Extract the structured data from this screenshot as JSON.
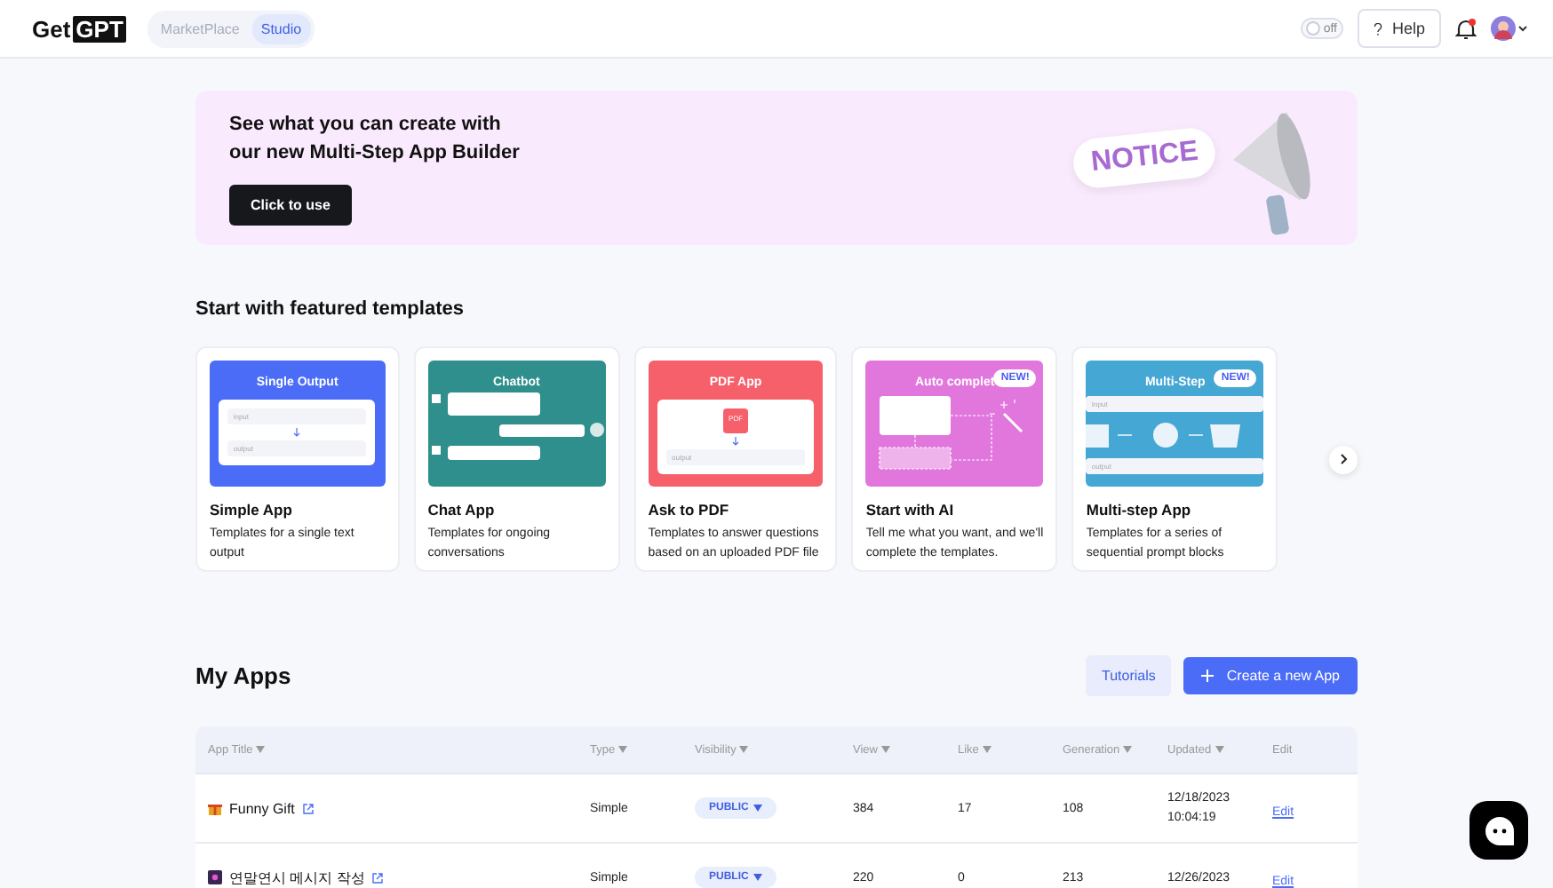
{
  "header": {
    "logo": {
      "plain": "Get",
      "boxed": "GPT"
    },
    "nav": [
      {
        "label": "MarketPlace",
        "selected": false
      },
      {
        "label": "Studio",
        "selected": true
      }
    ],
    "toggle": {
      "label": "off",
      "on": false
    },
    "help": "Help"
  },
  "banner": {
    "title": "See what you can create with\nour new Multi-Step App Builder",
    "button": "Click to use",
    "notice": "NOTICE"
  },
  "featured": {
    "heading": "Start with featured templates",
    "cards": [
      {
        "kind": "single",
        "color": "#4a6cf7",
        "thumb_title": "Single Output",
        "thumb_texts": [
          "input",
          "output"
        ],
        "title": "Simple App",
        "description": "Templates for a single text output"
      },
      {
        "kind": "chat",
        "color": "#2e8f8c",
        "thumb_title": "Chatbot",
        "title": "Chat App",
        "description": "Templates for ongoing conversations"
      },
      {
        "kind": "pdf",
        "color": "#f5606a",
        "thumb_title": "PDF App",
        "thumb_texts": [
          "PDF",
          "output"
        ],
        "title": "Ask to PDF",
        "description": "Templates to answer questions based on an uploaded PDF file"
      },
      {
        "kind": "auto",
        "color": "#e177dd",
        "thumb_title": "Auto complet",
        "badge": "NEW!",
        "title": "Start with AI",
        "description": "Tell me what you want, and we'll complete the templates."
      },
      {
        "kind": "multi",
        "color": "#45a7d4",
        "thumb_title": "Multi-Step",
        "badge": "NEW!",
        "thumb_texts": [
          "Input",
          "output"
        ],
        "title": "Multi-step App",
        "description": "Templates for a series of sequential prompt blocks"
      }
    ]
  },
  "my_apps": {
    "heading": "My Apps",
    "tutorials": "Tutorials",
    "create": "Create a new App",
    "columns": [
      {
        "label": "App Title",
        "sortable": true
      },
      {
        "label": "Type",
        "sortable": true
      },
      {
        "label": "Visibility",
        "sortable": true
      },
      {
        "label": "View",
        "sortable": true
      },
      {
        "label": "Like",
        "sortable": true
      },
      {
        "label": "Generation",
        "sortable": true
      },
      {
        "label": "Updated",
        "sortable": true
      },
      {
        "label": "Edit",
        "sortable": false
      }
    ],
    "rows": [
      {
        "kind": "gift",
        "title": "Funny Gift",
        "type": "Simple",
        "visibility": "PUBLIC",
        "view": "384",
        "like": "17",
        "generation": "108",
        "updated": [
          "12/18/2023",
          "10:04:19"
        ],
        "edit": "Edit"
      },
      {
        "kind": "square",
        "title": "연말연시 메시지 작성",
        "type": "Simple",
        "visibility": "PUBLIC",
        "view": "220",
        "like": "0",
        "generation": "213",
        "updated": [
          "12/26/2023"
        ],
        "edit": "Edit"
      }
    ]
  }
}
